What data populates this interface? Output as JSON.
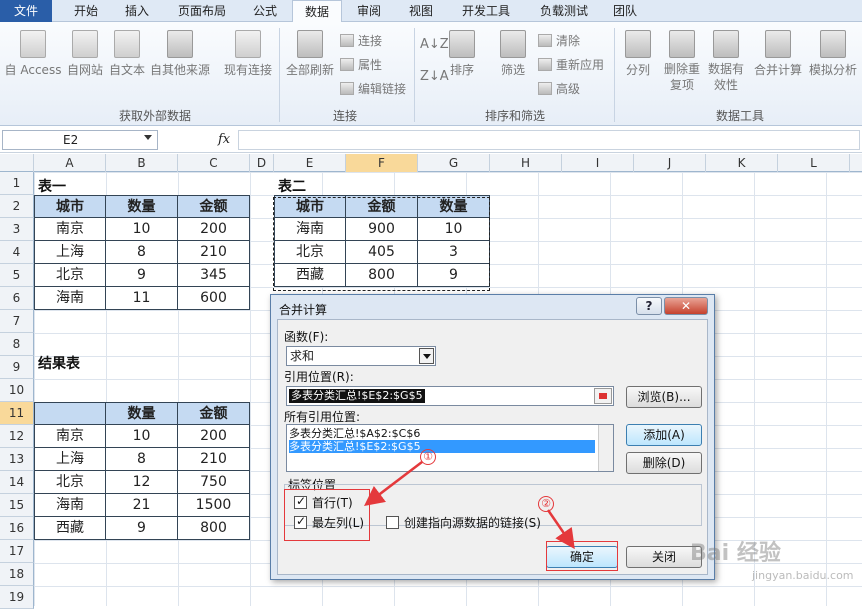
{
  "tabs": [
    "文件",
    "开始",
    "插入",
    "页面布局",
    "公式",
    "数据",
    "审阅",
    "视图",
    "开发工具",
    "负载测试",
    "团队"
  ],
  "ribbon": {
    "ext_data": {
      "label": "获取外部数据",
      "buttons": [
        "自 Access",
        "自网站",
        "自文本",
        "自其他来源",
        "现有连接"
      ]
    },
    "connections": {
      "label": "连接",
      "refresh_all": "全部刷新",
      "items": [
        "连接",
        "属性",
        "编辑链接"
      ]
    },
    "sort_filter": {
      "label": "排序和筛选",
      "sort": "排序",
      "filter": "筛选",
      "items": [
        "清除",
        "重新应用",
        "高级"
      ]
    },
    "data_tools": {
      "label": "数据工具",
      "buttons": [
        "分列",
        "删除重复项",
        "数据有效性",
        "合并计算",
        "模拟分析"
      ]
    }
  },
  "formula_bar": {
    "name_box": "E2",
    "fx": "fx",
    "value": ""
  },
  "columns": [
    "A",
    "B",
    "C",
    "D",
    "E",
    "F",
    "G",
    "H",
    "I",
    "J",
    "K",
    "L"
  ],
  "selected_column": "F",
  "rows": [
    "1",
    "2",
    "3",
    "4",
    "5",
    "6",
    "7",
    "8",
    "9",
    "10",
    "11",
    "12",
    "13",
    "14",
    "15",
    "16",
    "17",
    "18",
    "19"
  ],
  "selected_row": "11",
  "sheet": {
    "table1": {
      "title": "表一",
      "headers": [
        "城市",
        "数量",
        "金额"
      ],
      "rows": [
        [
          "南京",
          "10",
          "200"
        ],
        [
          "上海",
          "8",
          "210"
        ],
        [
          "北京",
          "9",
          "345"
        ],
        [
          "海南",
          "11",
          "600"
        ]
      ]
    },
    "table2": {
      "title": "表二",
      "headers": [
        "城市",
        "金额",
        "数量"
      ],
      "rows": [
        [
          "海南",
          "900",
          "10"
        ],
        [
          "北京",
          "405",
          "3"
        ],
        [
          "西藏",
          "800",
          "9"
        ]
      ]
    },
    "result": {
      "title": "结果表",
      "headers": [
        "",
        "数量",
        "金额"
      ],
      "rows": [
        [
          "南京",
          "10",
          "200"
        ],
        [
          "上海",
          "8",
          "210"
        ],
        [
          "北京",
          "12",
          "750"
        ],
        [
          "海南",
          "21",
          "1500"
        ],
        [
          "西藏",
          "9",
          "800"
        ]
      ]
    }
  },
  "dialog": {
    "title": "合并计算",
    "help": "?",
    "close": "✕",
    "function_label": "函数(F):",
    "function_value": "求和",
    "reference_label": "引用位置(R):",
    "reference_value": "多表分类汇总!$E$2:$G$5",
    "browse": "浏览(B)...",
    "all_refs_label": "所有引用位置:",
    "all_refs": [
      "多表分类汇总!$A$2:$C$6",
      "多表分类汇总!$E$2:$G$5"
    ],
    "add": "添加(A)",
    "delete": "删除(D)",
    "label_group": "标签位置",
    "first_row": "首行(T)",
    "left_column": "最左列(L)",
    "create_links": "创建指向源数据的链接(S)",
    "ok": "确定",
    "cancel": "关闭"
  },
  "annotations": [
    "①",
    "②"
  ],
  "watermark": {
    "main": "Bai 经验",
    "sub": "jingyan.baidu.com"
  }
}
